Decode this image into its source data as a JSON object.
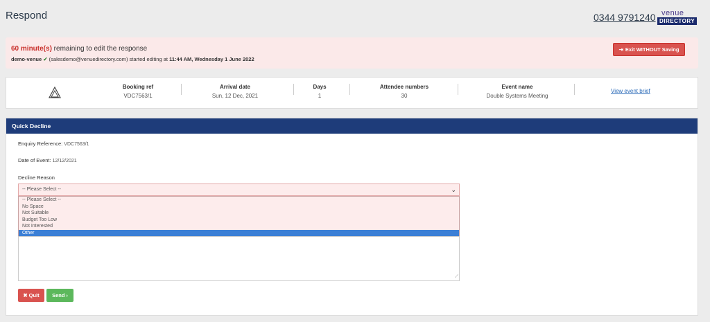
{
  "header": {
    "title": "Respond",
    "phone": "0344 9791240",
    "logo_top": "venue",
    "logo_bottom": "DIRECTORY"
  },
  "alert": {
    "minutes": "60 minute(s)",
    "message": " remaining to edit the response",
    "user": "demo-venue",
    "email": "(salesdemo@venuedirectory.com) started editing at ",
    "time": "11:44 AM, Wednesday 1 June 2022",
    "exit_label": "Exit WITHOUT Saving"
  },
  "summary": {
    "booking_ref_label": "Booking ref",
    "booking_ref": "VDC7563/1",
    "arrival_label": "Arrival date",
    "arrival": "Sun, 12 Dec, 2021",
    "days_label": "Days",
    "days": "1",
    "attendees_label": "Attendee numbers",
    "attendees": "30",
    "event_label": "Event name",
    "event": "Double Systems Meeting",
    "brief_link": "View event brief"
  },
  "panel": {
    "title": "Quick Decline",
    "enquiry_label": "Enquiry Reference:",
    "enquiry": "VDC7563/1",
    "date_label": "Date of Event:",
    "date": "12/12/2021",
    "decline_label": "Decline Reason",
    "selected": "-- Please Select --",
    "options": [
      "-- Please Select --",
      "No Space",
      "Not Suitable",
      "Budget Too Low",
      "Not Interested",
      "Other"
    ],
    "highlighted_option": "Other",
    "quit_label": "Quit",
    "send_label": "Send"
  },
  "colors": {
    "panel_header": "#1e3c7a",
    "danger": "#d9534f",
    "success": "#5cb85c",
    "highlight": "#3b7fd6"
  }
}
